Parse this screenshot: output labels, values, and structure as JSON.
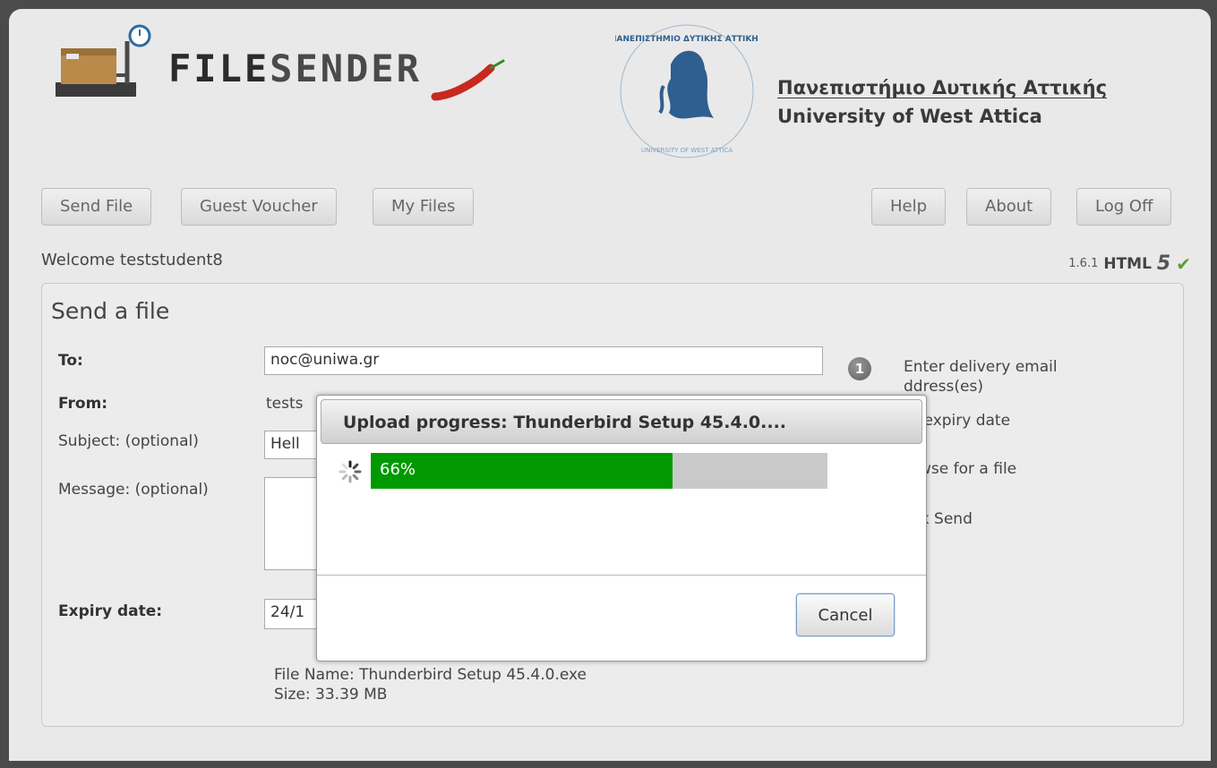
{
  "header": {
    "logo_text_a": "FILE",
    "logo_text_b": "SENDER",
    "university_gr": "Πανεπιστήμιο Δυτικής Αττικής",
    "university_en": "University of West Attica",
    "seal_text_top": "ΠΑΝΕΠΙΣΤΗΜΙΟ ΔΥΤΙΚΗΣ ΑΤΤΙΚΗΣ",
    "seal_text_bottom": "UNIVERSITY OF WEST ATTICA"
  },
  "nav": {
    "send_file": "Send File",
    "guest_voucher": "Guest Voucher",
    "my_files": "My Files",
    "help": "Help",
    "about": "About",
    "log_off": "Log Off"
  },
  "welcome": "Welcome teststudent8",
  "version": {
    "number": "1.6.1",
    "html": "HTML",
    "five": "5",
    "check": "✔"
  },
  "form": {
    "title": "Send a file",
    "to_label": "To:",
    "to_value": "noc@uniwa.gr",
    "from_label": "From:",
    "from_value": "tests",
    "subject_label": "Subject: (optional)",
    "subject_value": "Hell",
    "message_label": "Message: (optional)",
    "expiry_label": "Expiry date:",
    "expiry_value": "24/1",
    "file_name": "File Name: Thunderbird Setup 45.4.0.exe",
    "file_size": "Size: 33.39 MB"
  },
  "steps": {
    "step1_number": "1",
    "step1_line1": "Enter delivery email",
    "step1_line2": "ddress(es)",
    "step2": "et expiry date",
    "step3": "rowse for a file",
    "step4": "lick Send"
  },
  "modal": {
    "title": "Upload progress: Thunderbird Setup 45.4.0....",
    "progress_percent": 66,
    "progress_label": "66%",
    "cancel": "Cancel"
  },
  "colors": {
    "progress": "#009900",
    "track": "#c9c9c9"
  }
}
